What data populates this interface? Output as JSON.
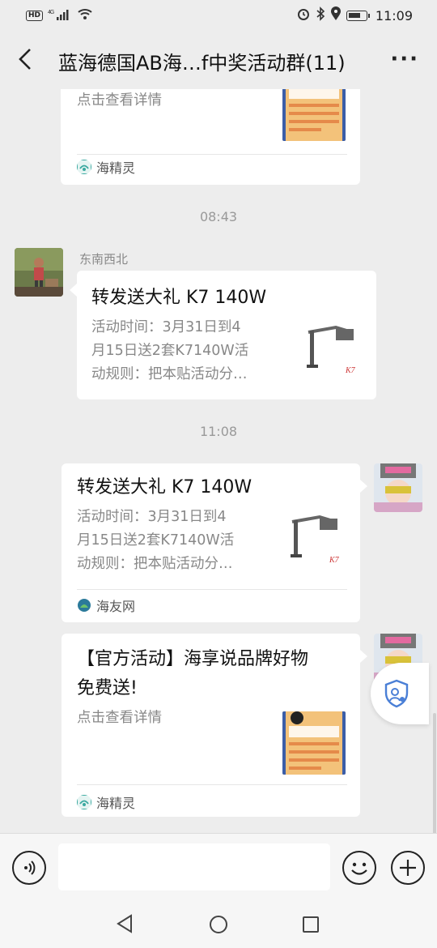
{
  "status_bar": {
    "hd": "HD",
    "network": "4G",
    "time": "11:09"
  },
  "header": {
    "title": "蓝海德国AB海…f中奖活动群(11)",
    "more": "···"
  },
  "messages": [
    {
      "type": "card",
      "desc": "点击查看详情",
      "source": "海精灵",
      "thumb": "hai-jingling-thumb"
    },
    {
      "type": "timestamp",
      "text": "08:43"
    },
    {
      "type": "card",
      "sender": "东南西北",
      "title": "转发送大礼 K7 140W",
      "desc": [
        "活动时间：3月31日到4",
        "月15日送2套K7140W活",
        "动规则：把本贴活动分…"
      ],
      "thumb_caption": "K7"
    },
    {
      "type": "timestamp",
      "text": "11:08"
    },
    {
      "type": "card",
      "title": "转发送大礼 K7 140W",
      "desc": [
        "活动时间：3月31日到4",
        "月15日送2套K7140W活",
        "动规则：把本贴活动分…"
      ],
      "thumb_caption": "K7",
      "source": "海友网"
    },
    {
      "type": "card",
      "title": [
        "【官方活动】海享说品牌好物",
        "免费送!"
      ],
      "desc": "点击查看详情",
      "source": "海精灵"
    }
  ],
  "colors": {
    "background": "#ededed",
    "card": "#ffffff",
    "meta_text": "#999999",
    "source_icon_teal": "#3aa9a0"
  }
}
